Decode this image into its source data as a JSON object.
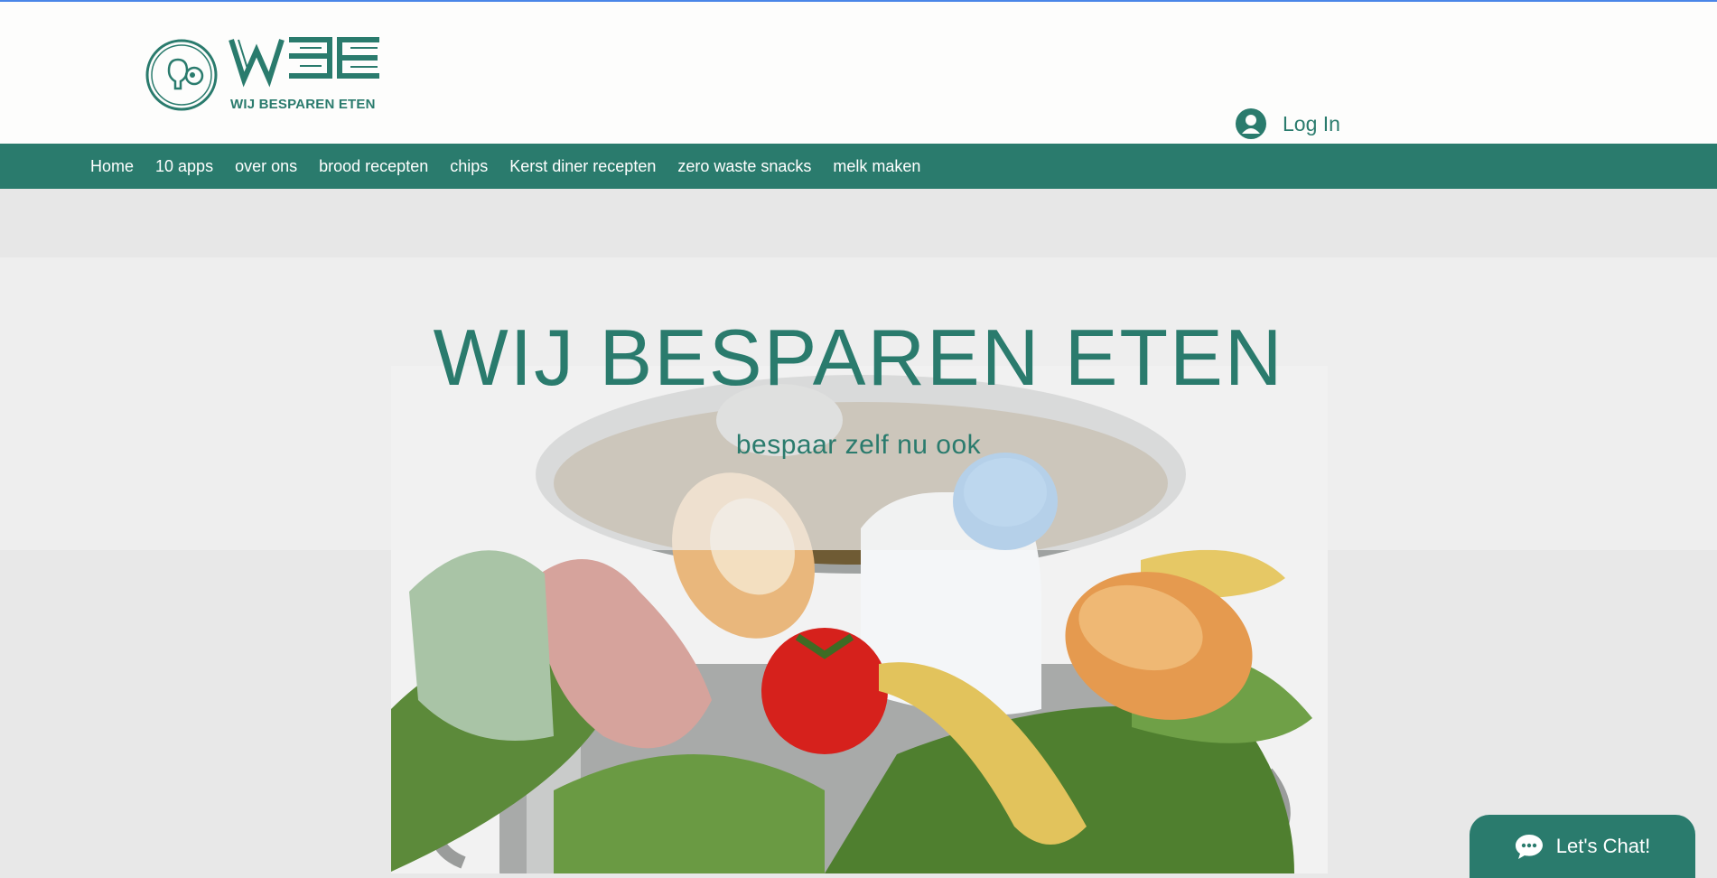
{
  "header": {
    "logo": {
      "wordmark": "WBE",
      "tagline": "WIJ BESPAREN ETEN"
    },
    "login": {
      "label": "Log In",
      "icon": "user-avatar-icon"
    }
  },
  "nav": {
    "items": [
      {
        "label": "Home"
      },
      {
        "label": "10 apps"
      },
      {
        "label": "over ons"
      },
      {
        "label": "brood recepten"
      },
      {
        "label": "chips"
      },
      {
        "label": "Kerst diner recepten"
      },
      {
        "label": "zero waste snacks"
      },
      {
        "label": "melk maken"
      }
    ]
  },
  "hero": {
    "title": "WIJ BESPAREN ETEN",
    "subtitle": "bespaar zelf nu ook",
    "image": "food-waste-bin-image"
  },
  "chat": {
    "label": "Let's Chat!",
    "icon": "chat-bubble-icon"
  },
  "colors": {
    "brand": "#2a7b6d",
    "nav_text": "#ffffff",
    "header_bg": "#fdfdfc",
    "page_bg": "#e8e8e8"
  }
}
